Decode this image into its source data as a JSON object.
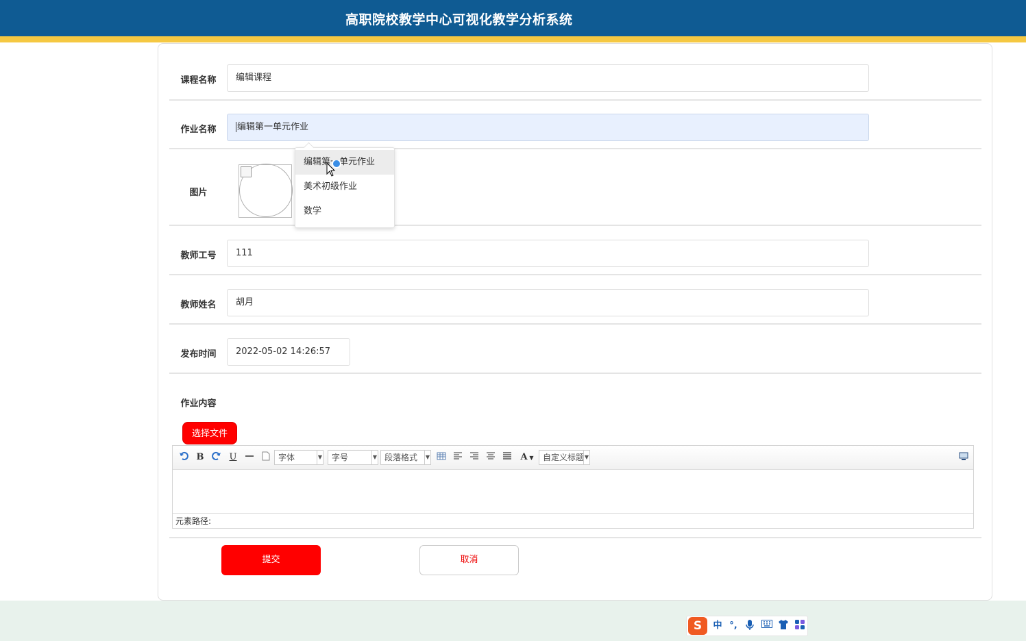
{
  "header": {
    "title": "高职院校教学中心可视化教学分析系统"
  },
  "form": {
    "course_name": {
      "label": "课程名称",
      "value": "编辑课程"
    },
    "homework_name": {
      "label": "作业名称",
      "value": "编辑第一单元作业"
    },
    "image": {
      "label": "图片"
    },
    "teacher_id": {
      "label": "教师工号",
      "value": "111"
    },
    "teacher_name": {
      "label": "教师姓名",
      "value": "胡月"
    },
    "publish_time": {
      "label": "发布时间",
      "value": "2022-05-02 14:26:57"
    },
    "content": {
      "label": "作业内容"
    }
  },
  "autocomplete": {
    "items": [
      "编辑第一单元作业",
      "美术初级作业",
      "数学"
    ]
  },
  "editor": {
    "file_button": "选择文件",
    "font_select": "字体",
    "size_select": "字号",
    "paragraph_select": "段落格式",
    "custom_heading_select": "自定义标题",
    "bold": "B",
    "underline": "U",
    "font_color": "A",
    "element_path": "元素路径:"
  },
  "actions": {
    "submit": "提交",
    "cancel": "取消"
  },
  "ime": {
    "logo": "S",
    "mode": "中",
    "punct": "°,",
    "accent_color": "#f05a22"
  },
  "colors": {
    "header_bg": "#0f5b93",
    "header_stripe": "#f5c842",
    "primary_red": "#ff0000"
  }
}
